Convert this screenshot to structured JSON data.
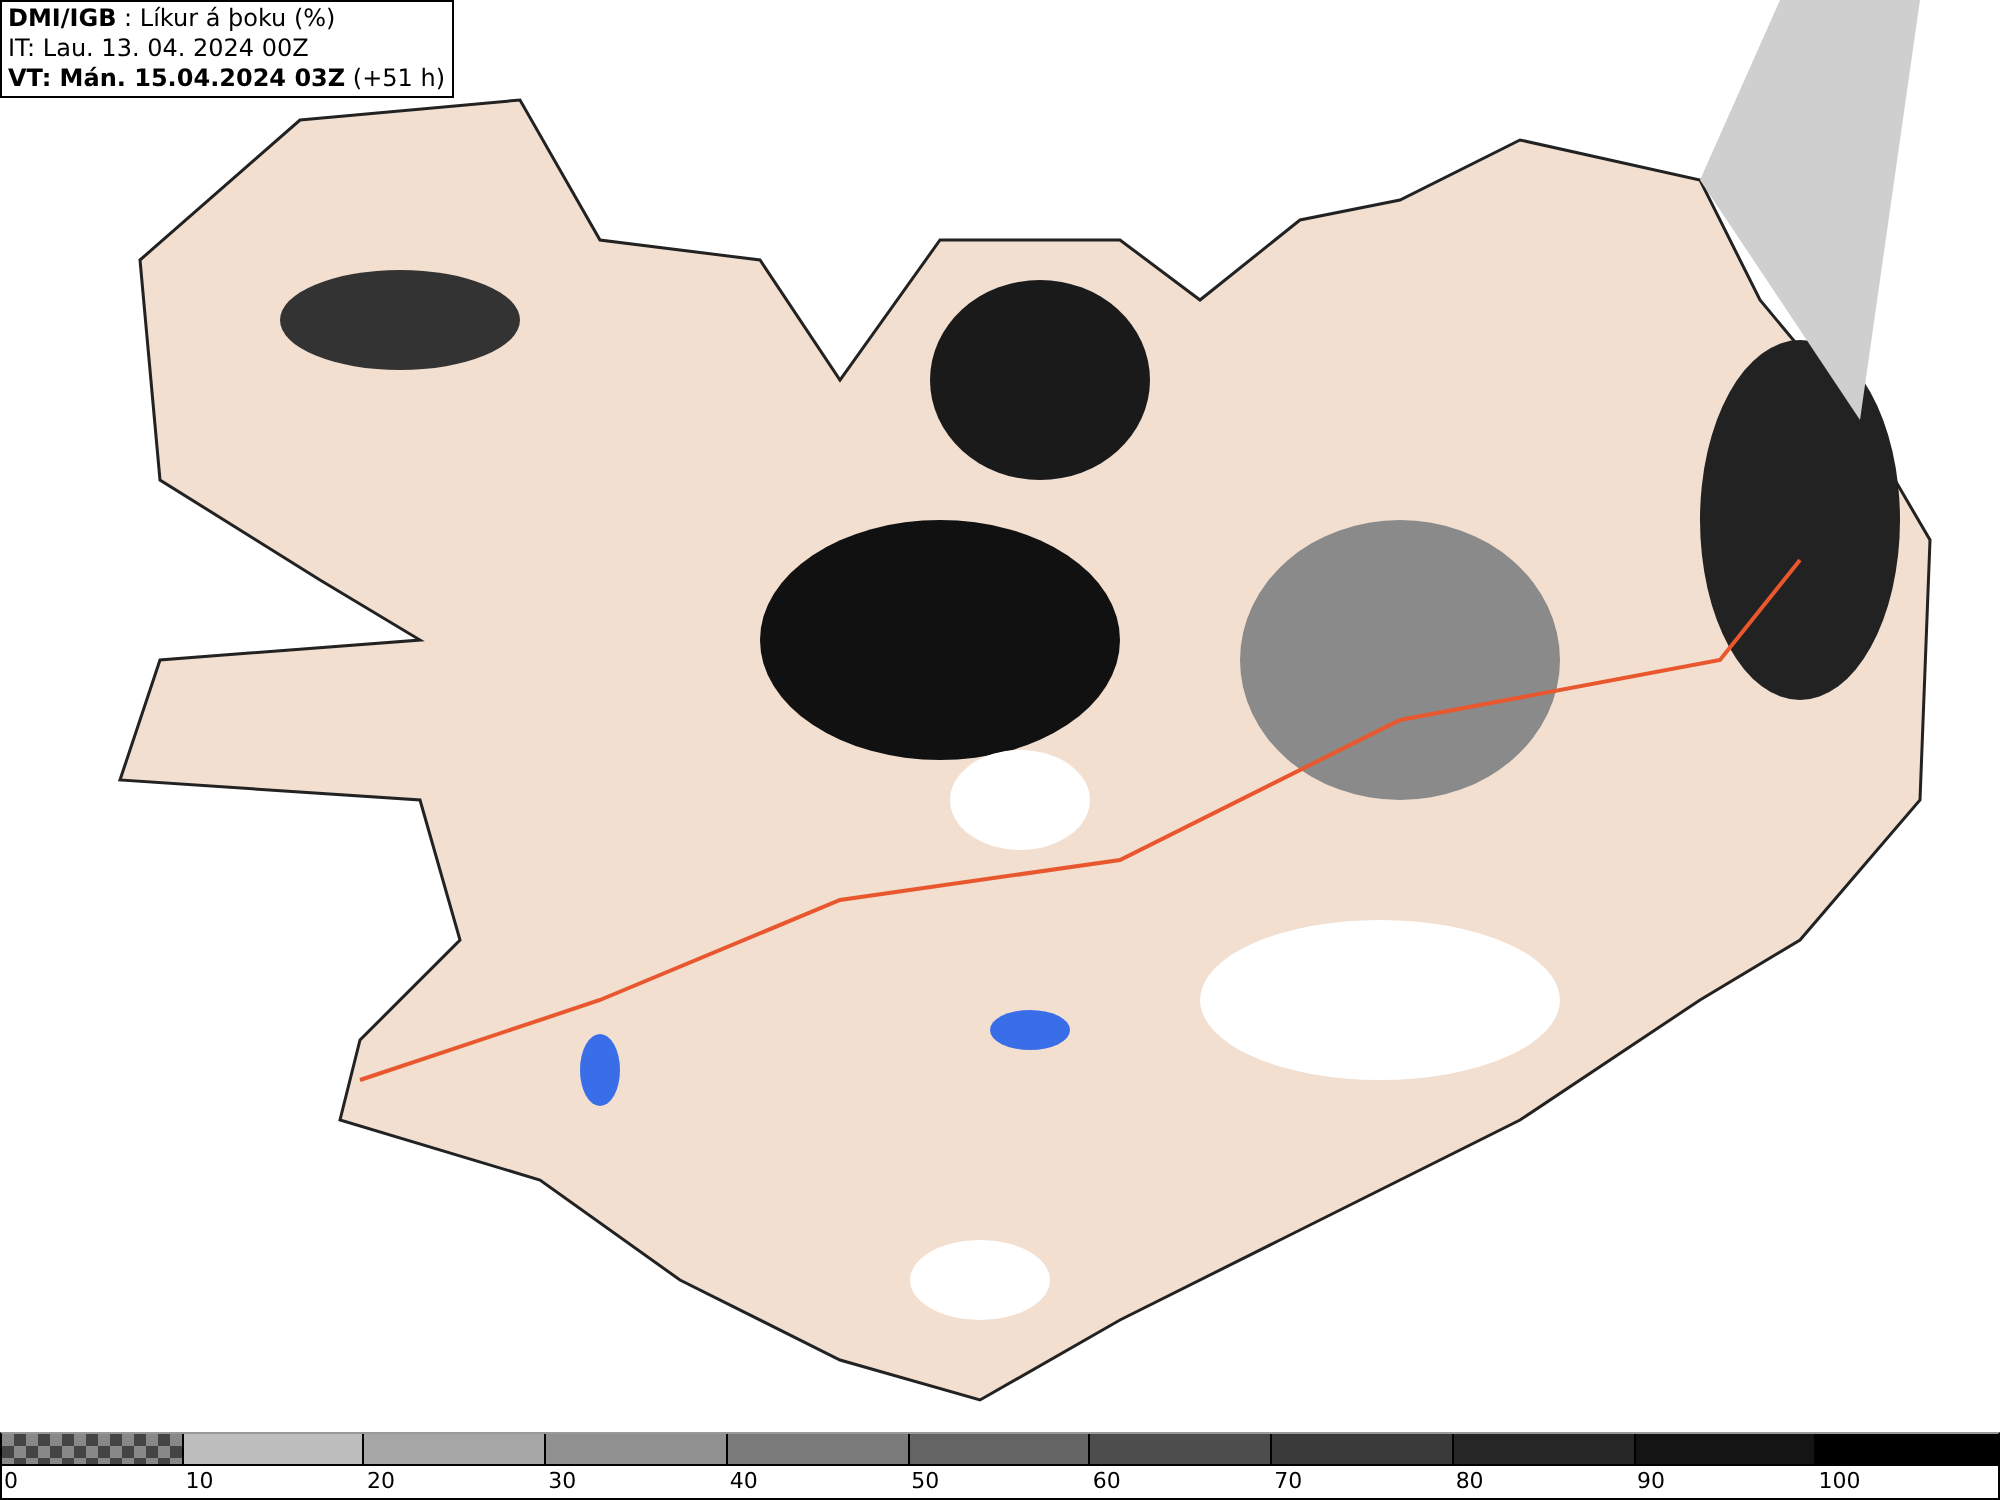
{
  "header": {
    "lines": [
      "**DMI/IGB** : Líkur á þoku (%)",
      "IT: Lau. 13. 04. 2024 00Z",
      "**VT: Mán. 15.04.2024 03Z** (+51 h)"
    ]
  },
  "legend": {
    "segments": [
      {
        "kind": "checker",
        "label": "0"
      },
      {
        "kind": "solid",
        "color": "#bdbdbd",
        "label": "10"
      },
      {
        "kind": "solid",
        "color": "#a6a6a6",
        "label": "20"
      },
      {
        "kind": "solid",
        "color": "#909090",
        "label": "30"
      },
      {
        "kind": "solid",
        "color": "#7a7a7a",
        "label": "40"
      },
      {
        "kind": "solid",
        "color": "#646464",
        "label": "50"
      },
      {
        "kind": "solid",
        "color": "#4d4d4d",
        "label": "60"
      },
      {
        "kind": "solid",
        "color": "#3a3a3a",
        "label": "70"
      },
      {
        "kind": "solid",
        "color": "#262626",
        "label": "80"
      },
      {
        "kind": "solid",
        "color": "#141414",
        "label": "90"
      },
      {
        "kind": "solid",
        "color": "#000000",
        "label": "100"
      }
    ]
  }
}
